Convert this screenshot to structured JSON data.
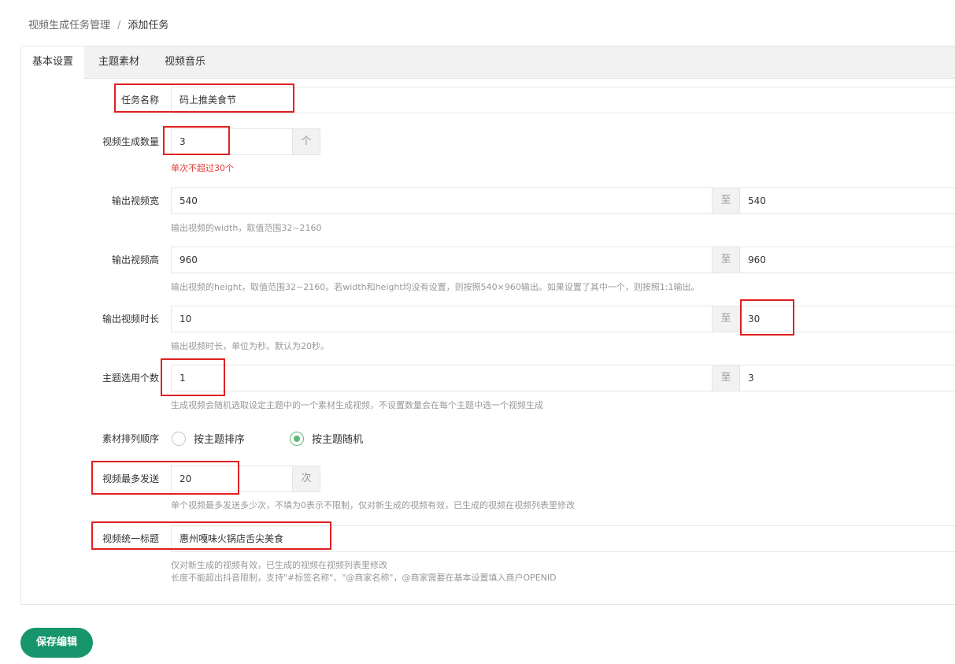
{
  "breadcrumb": {
    "parent": "视频生成任务管理",
    "separator": "/",
    "current": "添加任务"
  },
  "tabs": [
    {
      "label": "基本设置",
      "active": true
    },
    {
      "label": "主题素材",
      "active": false
    },
    {
      "label": "视频音乐",
      "active": false
    }
  ],
  "form": {
    "task_name": {
      "label": "任务名称",
      "value": "码上推美食节"
    },
    "video_count": {
      "label": "视频生成数量",
      "value": "3",
      "unit": "个",
      "hint": "单次不超过30个"
    },
    "width": {
      "label": "输出视频宽",
      "from": "540",
      "to_word": "至",
      "to": "540",
      "hint": "输出视频的width，取值范围32~2160"
    },
    "height": {
      "label": "输出视频高",
      "from": "960",
      "to_word": "至",
      "to": "960",
      "hint": "输出视频的height，取值范围32~2160。若width和height均没有设置，则按照540×960输出。如果设置了其中一个，则按照1:1输出。"
    },
    "duration": {
      "label": "输出视频时长",
      "from": "10",
      "to_word": "至",
      "to": "30",
      "hint": "输出视频时长，单位为秒。默认为20秒。"
    },
    "theme_count": {
      "label": "主题选用个数",
      "from": "1",
      "to_word": "至",
      "to": "3",
      "hint": "生成视频会随机选取设定主题中的一个素材生成视频，不设置数量会在每个主题中选一个视频生成"
    },
    "order": {
      "label": "素材排列顺序",
      "options": [
        {
          "label": "按主题排序",
          "checked": false
        },
        {
          "label": "按主题随机",
          "checked": true
        }
      ]
    },
    "max_send": {
      "label": "视频最多发送",
      "value": "20",
      "unit": "次",
      "hint": "单个视频最多发送多少次，不填为0表示不限制，仅对新生成的视频有效，已生成的视频在视频列表里修改"
    },
    "title": {
      "label": "视频统一标题",
      "value": "惠州嘎味火锅店舌尖美食",
      "hint1": "仅对新生成的视频有效，已生成的视频在视频列表里修改",
      "hint2": "长度不能超出抖音限制，支持\"#标签名称\"、\"@商家名称\"，@商家需要在基本设置填入商户OPENID"
    }
  },
  "save_button": "保存编辑",
  "colors": {
    "accent": "#17956d",
    "radio_checked": "#5fb878",
    "highlight_box": "#e02020",
    "warning_text": "#e53935"
  }
}
